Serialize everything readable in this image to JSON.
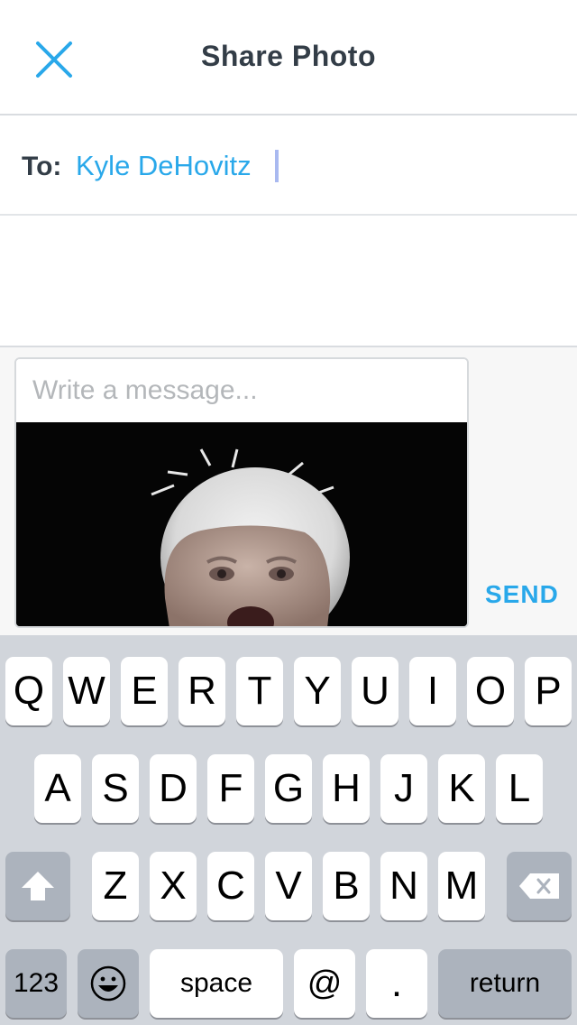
{
  "header": {
    "title": "Share Photo",
    "close_icon": "close-x-icon",
    "accent_color": "#29a8ea"
  },
  "to_row": {
    "label": "To:",
    "recipient": "Kyle DeHovitz"
  },
  "compose": {
    "placeholder": "Write a message...",
    "send_label": "SEND",
    "photo_icon": "attached-photo"
  },
  "keyboard": {
    "row1": [
      "Q",
      "W",
      "E",
      "R",
      "T",
      "Y",
      "U",
      "I",
      "O",
      "P"
    ],
    "row2": [
      "A",
      "S",
      "D",
      "F",
      "G",
      "H",
      "J",
      "K",
      "L"
    ],
    "row3": [
      "Z",
      "X",
      "C",
      "V",
      "B",
      "N",
      "M"
    ],
    "shift_icon": "shift-arrow-icon",
    "delete_icon": "backspace-icon",
    "emoji_icon": "emoji-smiley-icon",
    "numbers_label": "123",
    "space_label": "space",
    "at_label": "@",
    "period_label": ".",
    "return_label": "return"
  }
}
